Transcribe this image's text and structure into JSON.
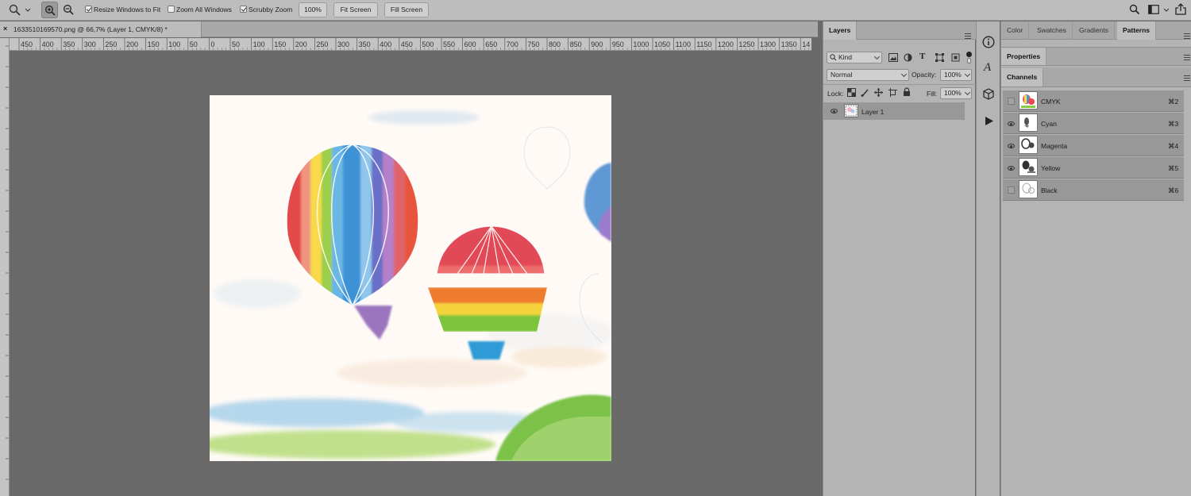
{
  "options_bar": {
    "tool_icon": "zoom-tool-icon",
    "resize_windows": {
      "label": "Resize Windows to Fit",
      "checked": true
    },
    "zoom_all_windows": {
      "label": "Zoom All Windows",
      "checked": false
    },
    "scrubby_zoom": {
      "label": "Scrubby Zoom",
      "checked": true
    },
    "zoom_100_label": "100%",
    "fit_screen_label": "Fit Screen",
    "fill_screen_label": "Fill Screen"
  },
  "document": {
    "tab_title": "1633510169570.png @ 66,7% (Layer 1, CMYK/8) *",
    "close_glyph": "×"
  },
  "ruler": {
    "labels": [
      "450",
      "400",
      "350",
      "300",
      "250",
      "200",
      "150",
      "100",
      "50",
      "0",
      "50",
      "100",
      "150",
      "200",
      "250",
      "300",
      "350",
      "400",
      "450",
      "500",
      "550",
      "600",
      "650",
      "700",
      "750",
      "800",
      "850",
      "900",
      "950",
      "1000",
      "1050",
      "1100",
      "1150",
      "1200",
      "1250",
      "1300",
      "1350",
      "14"
    ]
  },
  "layers_panel": {
    "tab_label": "Layers",
    "filter_label": "Kind",
    "blend_mode": "Normal",
    "opacity_label": "Opacity:",
    "opacity_value": "100%",
    "lock_label": "Lock:",
    "fill_label": "Fill:",
    "fill_value": "100%",
    "layers": [
      {
        "name": "Layer 1",
        "visible": true
      }
    ]
  },
  "right_dock": {
    "top_tabs": [
      "Color",
      "Swatches",
      "Gradients",
      "Patterns"
    ],
    "active_top_tab": "Patterns",
    "properties_label": "Properties",
    "channels_label": "Channels",
    "channels": [
      {
        "name": "CMYK",
        "shortcut": "⌘2",
        "visible": false
      },
      {
        "name": "Cyan",
        "shortcut": "⌘3",
        "visible": true
      },
      {
        "name": "Magenta",
        "shortcut": "⌘4",
        "visible": true
      },
      {
        "name": "Yellow",
        "shortcut": "⌘5",
        "visible": true
      },
      {
        "name": "Black",
        "shortcut": "⌘6",
        "visible": false
      }
    ]
  },
  "colors": {
    "app_bg": "#6a6a6a",
    "panel_bg": "#b4b4b4",
    "selected_row": "#989898"
  }
}
